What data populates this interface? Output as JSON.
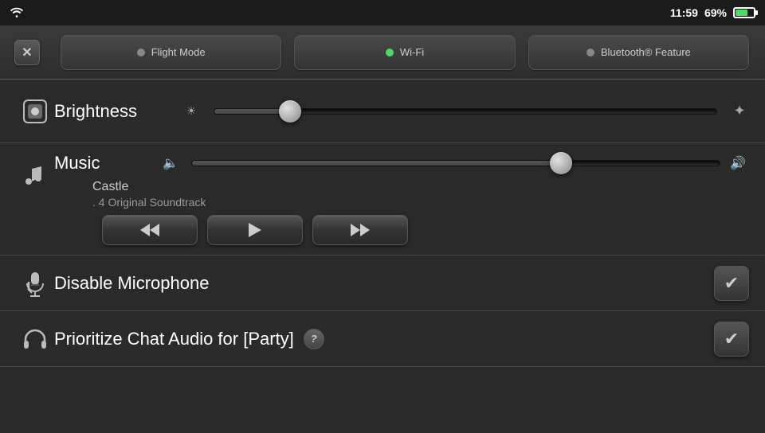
{
  "statusBar": {
    "time": "11:59",
    "battery": "69%"
  },
  "tabs": [
    {
      "label": "Flight Mode",
      "dot": "grey"
    },
    {
      "label": "Wi-Fi",
      "dot": "green"
    },
    {
      "label": "Bluetooth® Feature",
      "dot": "grey"
    }
  ],
  "closeBtn": "✕",
  "brightness": {
    "label": "Brightness",
    "sliderValue": 15
  },
  "music": {
    "label": "Music",
    "track": "Castle",
    "album": " . 4 Original Soundtrack",
    "volumeValue": 70
  },
  "disableMic": {
    "label": "Disable Microphone",
    "checked": true
  },
  "chatAudio": {
    "label": "Prioritize Chat Audio for [Party]",
    "checked": true
  },
  "helpBtn": "?",
  "controls": {
    "rewind": "⏮",
    "play": "▶",
    "fastforward": "⏭"
  }
}
